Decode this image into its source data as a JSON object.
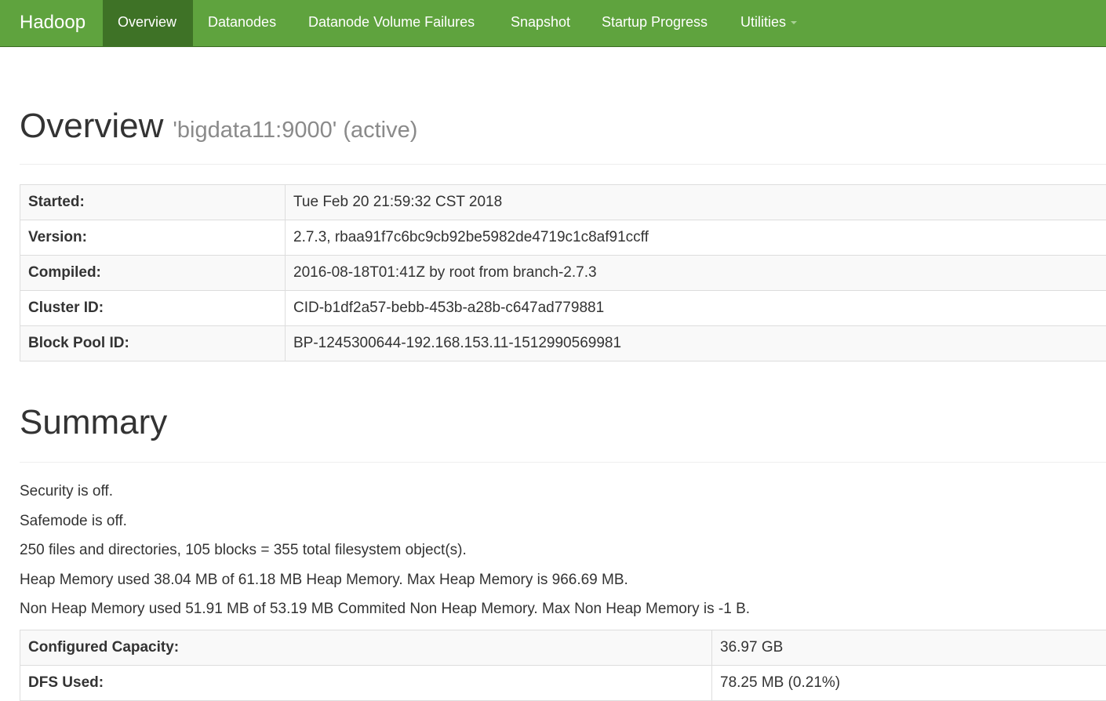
{
  "navbar": {
    "brand": "Hadoop",
    "items": [
      {
        "label": "Overview",
        "active": true
      },
      {
        "label": "Datanodes"
      },
      {
        "label": "Datanode Volume Failures"
      },
      {
        "label": "Snapshot"
      },
      {
        "label": "Startup Progress"
      },
      {
        "label": "Utilities",
        "dropdown": true
      }
    ]
  },
  "overview": {
    "title": "Overview",
    "subtitle": "'bigdata11:9000' (active)",
    "rows": [
      {
        "key": "Started:",
        "value": "Tue Feb 20 21:59:32 CST 2018"
      },
      {
        "key": "Version:",
        "value": "2.7.3, rbaa91f7c6bc9cb92be5982de4719c1c8af91ccff"
      },
      {
        "key": "Compiled:",
        "value": "2016-08-18T01:41Z by root from branch-2.7.3"
      },
      {
        "key": "Cluster ID:",
        "value": "CID-b1df2a57-bebb-453b-a28b-c647ad779881"
      },
      {
        "key": "Block Pool ID:",
        "value": "BP-1245300644-192.168.153.11-1512990569981"
      }
    ]
  },
  "summary": {
    "title": "Summary",
    "lines": [
      "Security is off.",
      "Safemode is off.",
      "250 files and directories, 105 blocks = 355 total filesystem object(s).",
      "Heap Memory used 38.04 MB of 61.18 MB Heap Memory. Max Heap Memory is 966.69 MB.",
      "Non Heap Memory used 51.91 MB of 53.19 MB Commited Non Heap Memory. Max Non Heap Memory is -1 B."
    ],
    "rows": [
      {
        "key": "Configured Capacity:",
        "value": "36.97 GB"
      },
      {
        "key": "DFS Used:",
        "value": "78.25 MB (0.21%)"
      }
    ]
  },
  "colors": {
    "navbar_bg": "#5fa33e",
    "navbar_active_bg": "#3e7226",
    "text": "#333333"
  }
}
